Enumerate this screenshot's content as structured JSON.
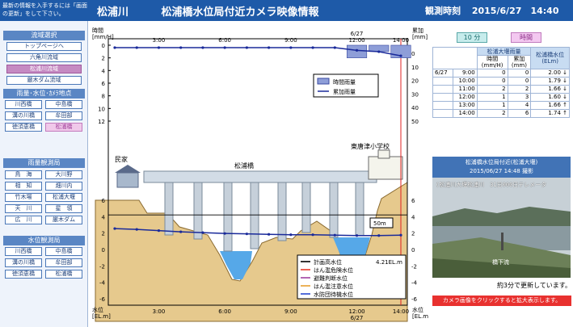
{
  "header": {
    "note": "最新の情報を入手するには「画面の更新」をして下さい。",
    "river": "松浦川",
    "title": "松浦橋水位局付近カメラ映像情報",
    "obs_label": "観測時刻",
    "obs_time": "2015/6/27　14:40"
  },
  "sidebar": {
    "basin_head": "流域選択",
    "basin": [
      "トップページへ",
      "六角川流域",
      "松浦川流域",
      "厳木ダム流域"
    ],
    "point_head": "雨量･水位･ｶﾒﾗ地点",
    "points": [
      [
        "川西橋",
        "中島橋"
      ],
      [
        "溝の川橋",
        "牟田部"
      ],
      [
        "徳須恵橋",
        "松浦橋"
      ]
    ],
    "rain_head": "雨量観測局",
    "rain": [
      [
        "鳥　海",
        "大川野"
      ],
      [
        "相　知",
        "畑川内"
      ],
      [
        "竹木場",
        "松浦大堰"
      ],
      [
        "天　川",
        "星　領"
      ],
      [
        "広　川",
        "厳木ダム"
      ]
    ],
    "water_head": "水位観測局",
    "water": [
      [
        "川西橋",
        "中島橋"
      ],
      [
        "溝の川橋",
        "牟田部"
      ],
      [
        "徳須恵橋",
        "松浦橋"
      ]
    ]
  },
  "chart_labels": {
    "left_unit_top": "時間\n[mm/H]",
    "right_unit_top": "累加\n[mm]",
    "left_unit_bottom": "水位\n[EL.m]",
    "right_unit_bottom": "水位\n[EL.m]",
    "date": "6/27",
    "time_ticks": [
      "3:00",
      "6:00",
      "9:00",
      "12:00",
      "14:00"
    ],
    "rain_ticks_left": [
      "0",
      "2",
      "4",
      "6",
      "8",
      "10",
      "12"
    ],
    "rain_ticks_right": [
      "0",
      "10",
      "20",
      "30",
      "40",
      "50"
    ],
    "level_ticks_left": [
      "6",
      "4",
      "2",
      "0",
      "-2",
      "-4",
      "-6"
    ],
    "level_ticks_right": [
      "6",
      "4",
      "2",
      "0",
      "-2",
      "-4",
      "-6"
    ],
    "legend_hourly": "時間雨量",
    "legend_cum": "累加雨量",
    "bridge_label": "松浦橋",
    "house_label": "民家",
    "school_label": "東唐津小学校",
    "scale_label": "50m",
    "level_legend": [
      {
        "name": "計画高水位",
        "value": "4.21EL.m",
        "color": "#000000"
      },
      {
        "name": "はん濫危険水位",
        "value": "",
        "color": "#e83a2a"
      },
      {
        "name": "避難判断水位",
        "value": "",
        "color": "#a040a0"
      },
      {
        "name": "はん濫注意水位",
        "value": "",
        "color": "#e8a030"
      },
      {
        "name": "水防団待機水位",
        "value": "",
        "color": "#2a4ad0"
      }
    ]
  },
  "chart_data": {
    "type": "line",
    "x": [
      "1:00",
      "2:00",
      "3:00",
      "4:00",
      "5:00",
      "6:00",
      "7:00",
      "8:00",
      "9:00",
      "10:00",
      "11:00",
      "12:00",
      "13:00",
      "14:00"
    ],
    "series": [
      {
        "name": "時間雨量",
        "unit": "mm/H",
        "values": [
          0,
          0,
          0,
          0,
          0,
          0,
          0,
          0,
          0,
          0,
          0,
          2,
          1,
          2
        ]
      },
      {
        "name": "累加雨量",
        "unit": "mm",
        "values": [
          0,
          0,
          0,
          0,
          0,
          0,
          0,
          0,
          0,
          0,
          0,
          2,
          3,
          6
        ]
      },
      {
        "name": "水位",
        "unit": "EL.m",
        "values": [
          2.55,
          2.45,
          2.3,
          2.15,
          2.05,
          1.95,
          1.9,
          1.85,
          1.8,
          1.8,
          1.75,
          1.7,
          1.7,
          1.75
        ]
      }
    ],
    "ylim_rain_left": [
      0,
      12
    ],
    "ylim_rain_right": [
      0,
      50
    ],
    "ylim_level": [
      -6,
      6
    ],
    "plan_high_water_level": 4.21
  },
  "right": {
    "tab10": "10 分",
    "tab60": "時間",
    "table_head": "松浦大堰雨量",
    "table_level_head": "松浦橋水位",
    "col_hourly": "時間\n(mm/H)",
    "col_cum": "累加\n(mm)",
    "col_level": "(ELm)",
    "rows": [
      {
        "date": "6/27",
        "time": "9:00",
        "h": "0",
        "c": "0",
        "lv": "2.00",
        "arrow": "↓"
      },
      {
        "date": "",
        "time": "10:00",
        "h": "0",
        "c": "0",
        "lv": "1.79",
        "arrow": "↓"
      },
      {
        "date": "",
        "time": "11:00",
        "h": "2",
        "c": "2",
        "lv": "1.66",
        "arrow": "↓"
      },
      {
        "date": "",
        "time": "12:00",
        "h": "1",
        "c": "3",
        "lv": "1.60",
        "arrow": "↓"
      },
      {
        "date": "",
        "time": "13:00",
        "h": "1",
        "c": "4",
        "lv": "1.66",
        "arrow": "↑"
      },
      {
        "date": "",
        "time": "14:00",
        "h": "2",
        "c": "6",
        "lv": "1.74",
        "arrow": "↑"
      }
    ],
    "cam_head": "松浦橋水位局付近(松浦大堰)",
    "cam_time": "2015/06/27 14:48 撮影",
    "cam_overlay": "(松浦川大堰松浦川　31日000日テレメータ",
    "cam_label": "橋下流",
    "update": "約3分で更新しています。",
    "enlarge": "カメラ画像をクリックすると拡大表示します。"
  }
}
